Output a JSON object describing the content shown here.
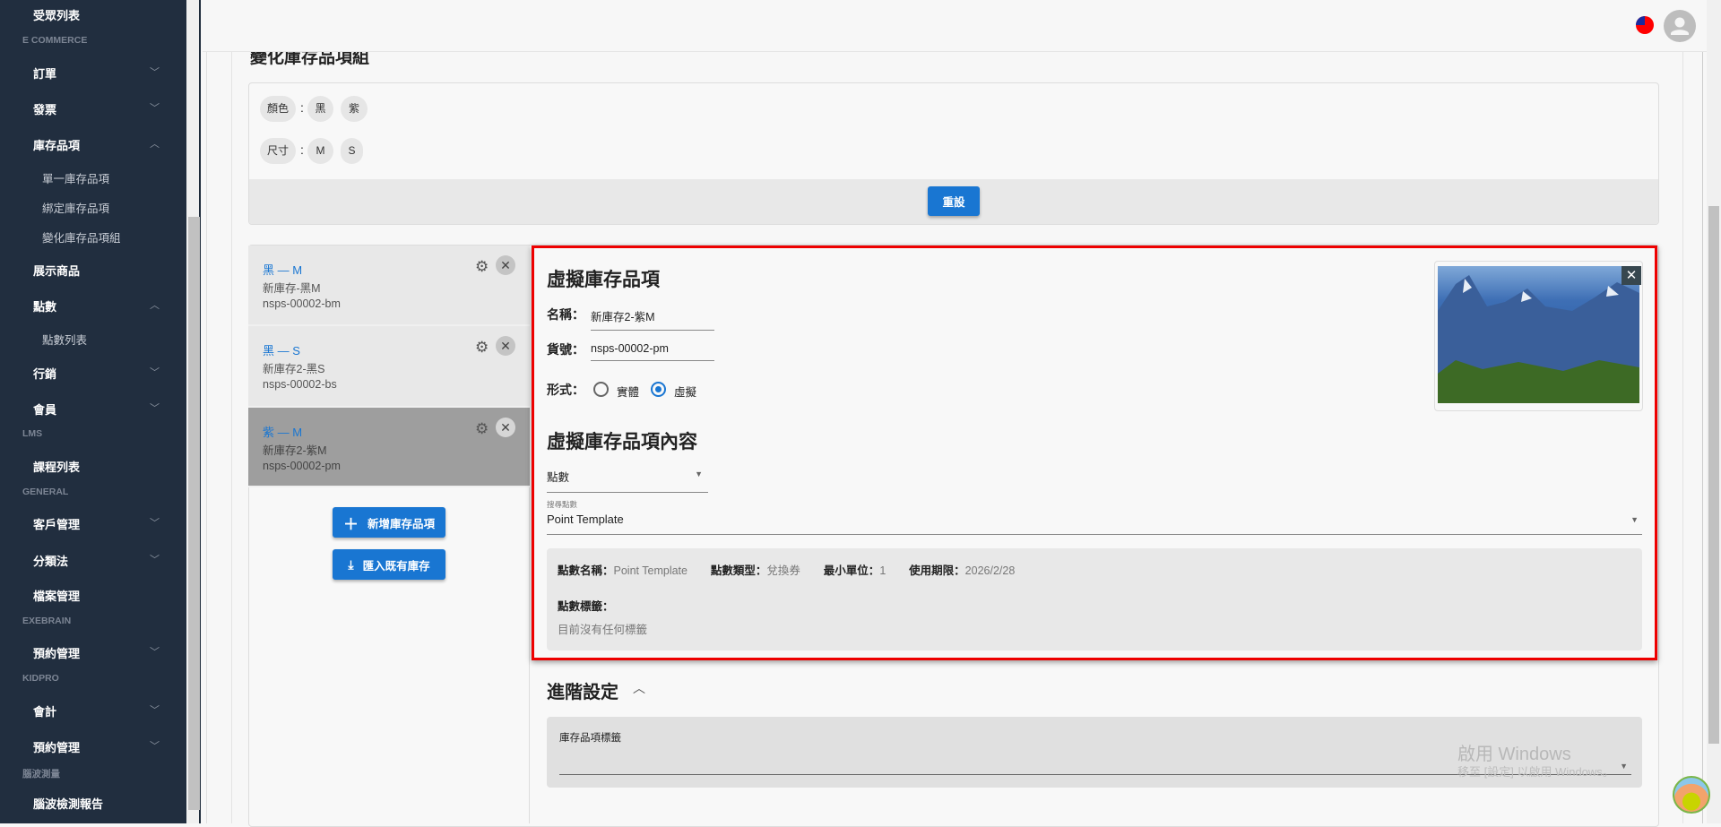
{
  "sidebar": {
    "items": [
      {
        "type": "item",
        "label": "受眾列表"
      },
      {
        "type": "head",
        "label": "E COMMERCE"
      },
      {
        "type": "item",
        "label": "訂單",
        "chevron": "down"
      },
      {
        "type": "item",
        "label": "發票",
        "chevron": "down"
      },
      {
        "type": "item",
        "label": "庫存品項",
        "chevron": "up"
      },
      {
        "type": "sub",
        "label": "單一庫存品項"
      },
      {
        "type": "sub",
        "label": "綁定庫存品項"
      },
      {
        "type": "sub",
        "label": "變化庫存品項組"
      },
      {
        "type": "item",
        "label": "展示商品"
      },
      {
        "type": "item",
        "label": "點數",
        "chevron": "up"
      },
      {
        "type": "sub",
        "label": "點數列表"
      },
      {
        "type": "item",
        "label": "行銷",
        "chevron": "down"
      },
      {
        "type": "item",
        "label": "會員",
        "chevron": "down"
      },
      {
        "type": "head",
        "label": "LMS"
      },
      {
        "type": "item",
        "label": "課程列表"
      },
      {
        "type": "head",
        "label": "GENERAL"
      },
      {
        "type": "item",
        "label": "客戶管理",
        "chevron": "down"
      },
      {
        "type": "item",
        "label": "分類法",
        "chevron": "down"
      },
      {
        "type": "item",
        "label": "檔案管理"
      },
      {
        "type": "head",
        "label": "EXEBRAIN"
      },
      {
        "type": "item",
        "label": "預約管理",
        "chevron": "down"
      },
      {
        "type": "head",
        "label": "KIDPRO"
      },
      {
        "type": "item",
        "label": "會計",
        "chevron": "down"
      },
      {
        "type": "item",
        "label": "預約管理",
        "chevron": "down"
      },
      {
        "type": "head",
        "label": "腦波測量"
      },
      {
        "type": "item",
        "label": "腦波檢測報告"
      }
    ]
  },
  "page": {
    "title": "變化庫存品項組"
  },
  "variants": {
    "options": [
      {
        "name": "顏色",
        "values": [
          "黑",
          "紫"
        ]
      },
      {
        "name": "尺寸",
        "values": [
          "M",
          "S"
        ]
      }
    ],
    "colon": ":",
    "reset_label": "重設"
  },
  "items": [
    {
      "title": "黑 — M",
      "name": "新庫存-黑M",
      "code": "nsps-00002-bm"
    },
    {
      "title": "黑 — S",
      "name": "新庫存2-黑S",
      "code": "nsps-00002-bs"
    },
    {
      "title": "紫 — M",
      "name": "新庫存2-紫M",
      "code": "nsps-00002-pm"
    }
  ],
  "actions": {
    "add_label": "新增庫存品項",
    "import_label": "匯入既有庫存"
  },
  "detail": {
    "title": "虛擬庫存品項",
    "name_label": "名稱：",
    "name_value": "新庫存2-紫M",
    "code_label": "貨號：",
    "code_value": "nsps-00002-pm",
    "form_label": "形式：",
    "form_options": [
      "實體",
      "虛擬"
    ],
    "form_selected": "虛擬",
    "content_title": "虛擬庫存品項內容",
    "content_type": "點數",
    "search_label": "搜尋點數",
    "search_value": "Point Template",
    "info": {
      "name_key": "點數名稱：",
      "name_val": "Point Template",
      "type_key": "點數類型：",
      "type_val": "兌換券",
      "unit_key": "最小單位：",
      "unit_val": "1",
      "expiry_key": "使用期限：",
      "expiry_val": "2026/2/28",
      "tags_key": "點數標籤：",
      "tags_empty": "目前沒有任何標籤"
    }
  },
  "advanced": {
    "title": "進階設定",
    "tags_label": "庫存品項標籤"
  },
  "watermark": {
    "line1": "啟用 Windows",
    "line2": "移至 [設定] 以啟用 Windows。"
  }
}
